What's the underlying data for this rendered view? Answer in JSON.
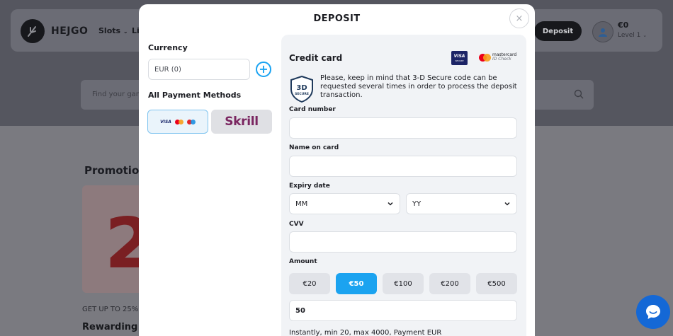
{
  "background": {
    "logo_text": "HEJGO",
    "nav": [
      {
        "label": "Slots"
      },
      {
        "label": "Li"
      }
    ],
    "deposit_label": "Deposit",
    "balance": "€0",
    "level": "Level 1",
    "search_placeholder": "Find your gam",
    "promotions_title": "Promotio",
    "promo_big": "2",
    "promo_subtitle": "GET UP TO 25%",
    "promo_heading": "Rewarding p"
  },
  "modal": {
    "title": "DEPOSIT",
    "close_icon": "×",
    "currency": {
      "label": "Currency",
      "value": "EUR (0)",
      "add_icon": "+"
    },
    "methods": {
      "label": "All Payment Methods",
      "cards_visa": "VISA",
      "skrill": "Skrill"
    },
    "credit_card": {
      "title": "Credit card",
      "visa_badge": "VISA",
      "visa_badge_sub": "SECURE",
      "mc_line1": "mastercard",
      "mc_line2": "ID Check",
      "secure_badge_top": "3D",
      "secure_badge_bottom": "SECURE",
      "secure_note": "Please, keep in mind that 3-D Secure code can be requested several times in order to process the deposit transaction.",
      "card_number_label": "Card number",
      "card_number_value": "",
      "name_label": "Name on card",
      "name_value": "",
      "expiry_label": "Expiry date",
      "month": "MM",
      "year": "YY",
      "cvv_label": "CVV",
      "cvv_value": "",
      "amount_label": "Amount",
      "amounts": [
        {
          "label": "€20",
          "active": false
        },
        {
          "label": "€50",
          "active": true
        },
        {
          "label": "€100",
          "active": false
        },
        {
          "label": "€200",
          "active": false
        },
        {
          "label": "€500",
          "active": false
        }
      ],
      "amount_value": "50",
      "info": "Instantly, min 20, max 4000, Payment EUR"
    }
  },
  "colors": {
    "accent": "#1ba3f0",
    "skrill": "#7a2560",
    "visa_navy": "#1c2466",
    "mc_red": "#eb001b",
    "mc_orange": "#f79e1b",
    "chat": "#1468d6"
  },
  "icons": {
    "close": "close-icon",
    "add": "plus-circle-icon",
    "chevron": "chevron-down-icon",
    "search": "search-icon",
    "chat": "chat-icon",
    "shield": "3d-secure-shield-icon"
  }
}
